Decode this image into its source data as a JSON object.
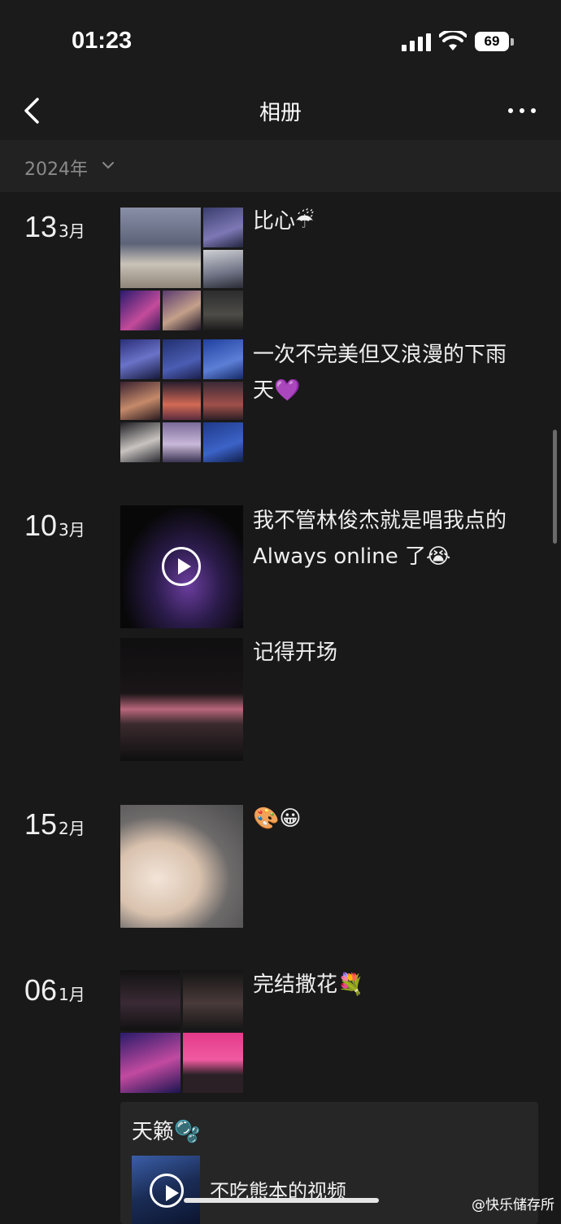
{
  "status_bar": {
    "time": "01:23",
    "battery": "69"
  },
  "nav": {
    "title": "相册",
    "back_icon": "chevron-left-icon",
    "more_icon": "more-horizontal-icon"
  },
  "year_filter": {
    "label": "2024年"
  },
  "entries": [
    {
      "day": "13",
      "month": "3月",
      "posts": [
        {
          "caption": "比心☔"
        },
        {
          "caption": "一次不完美但又浪漫的下雨天💜"
        }
      ]
    },
    {
      "day": "10",
      "month": "3月",
      "posts": [
        {
          "caption": "我不管林俊杰就是唱我点的 Always online 了😭"
        },
        {
          "caption": "记得开场"
        }
      ]
    },
    {
      "day": "15",
      "month": "2月",
      "posts": [
        {
          "caption": "🎨😀"
        }
      ]
    },
    {
      "day": "06",
      "month": "1月",
      "posts": [
        {
          "caption": "完结撒花💐"
        }
      ]
    }
  ],
  "share_card": {
    "title": "天籁🫧",
    "video_label": "不吃熊本的视频"
  },
  "watermark": "@快乐储存所"
}
